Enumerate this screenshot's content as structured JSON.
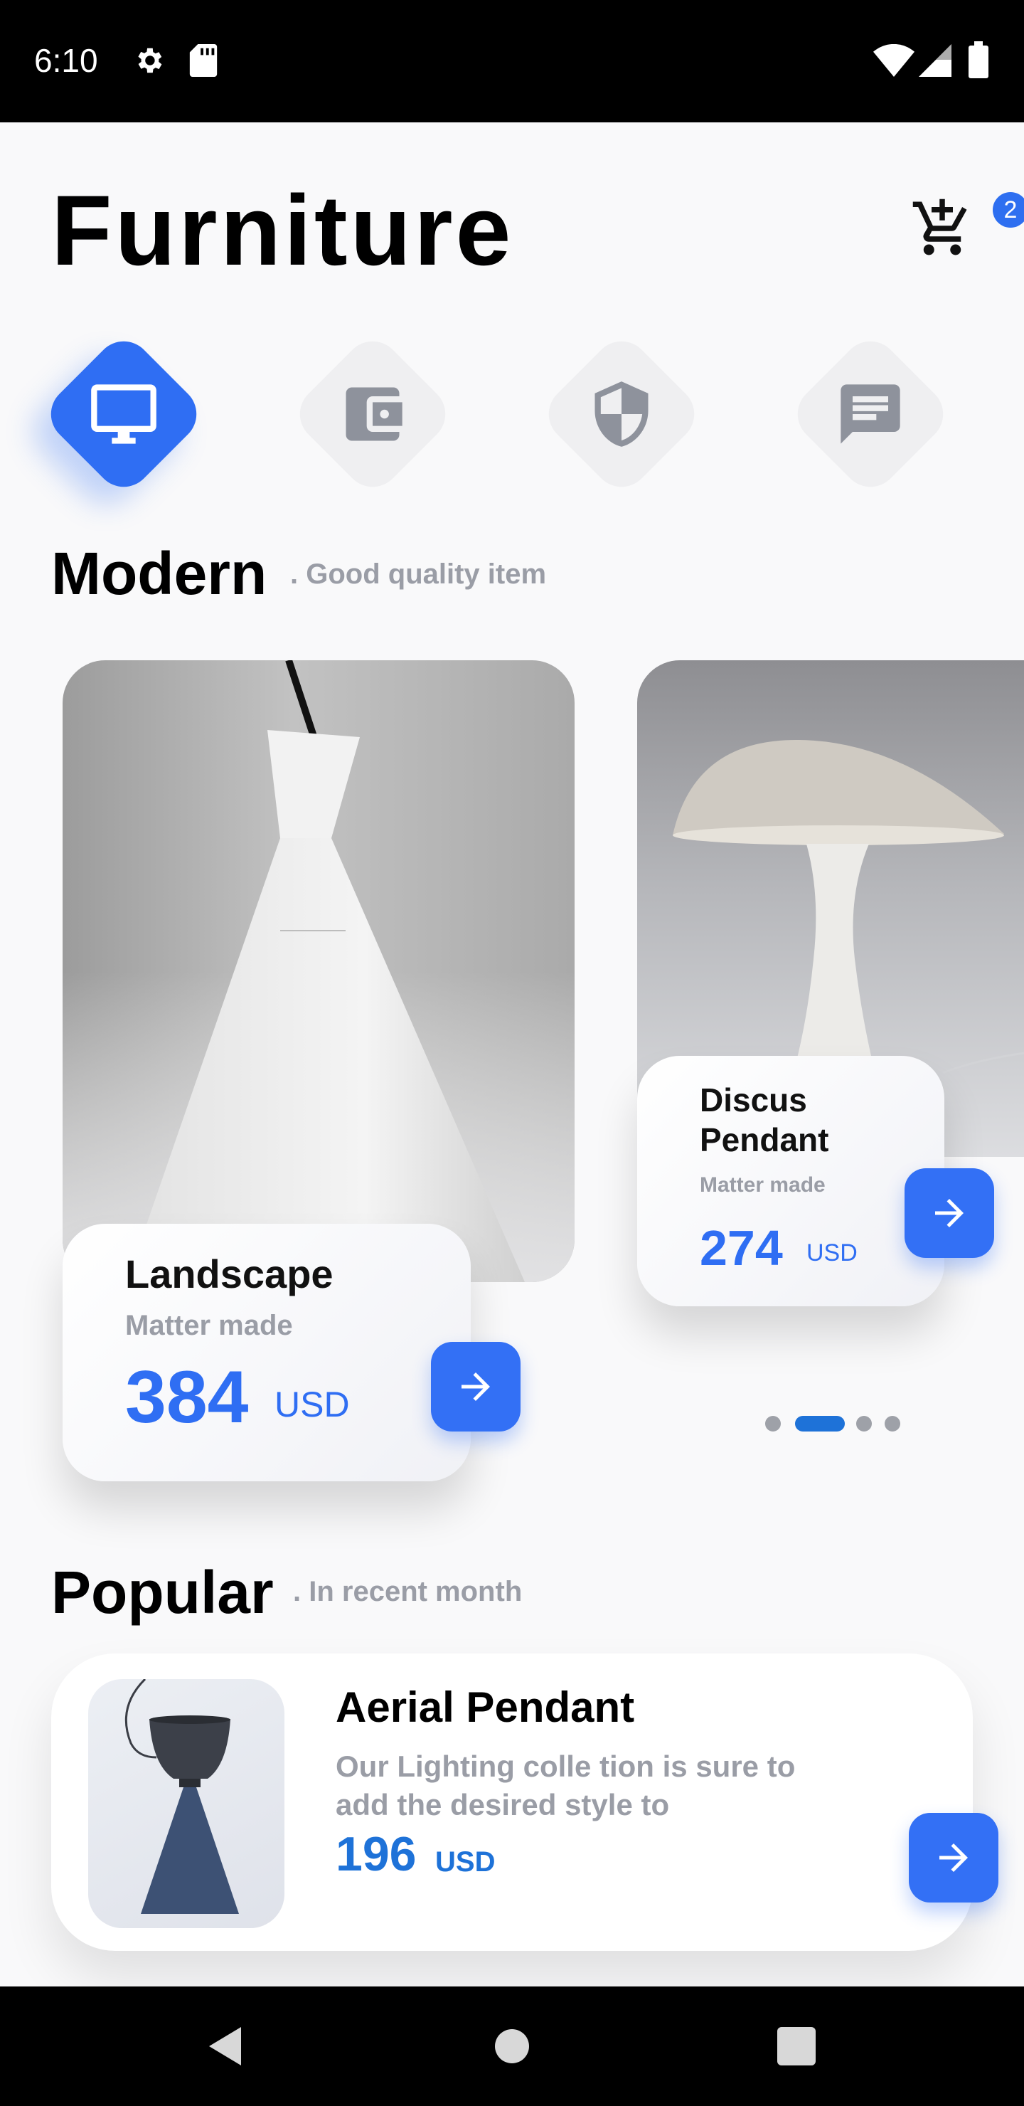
{
  "status_bar": {
    "time": "6:10",
    "left_icons": [
      "gear-icon",
      "sd-card-icon"
    ],
    "right_icons": [
      "wifi-icon",
      "signal-icon",
      "battery-icon"
    ]
  },
  "header": {
    "title": "Furniture",
    "cart_icon": "cart-add-icon",
    "cart_badge": "2"
  },
  "categories": [
    {
      "icon": "monitor-icon",
      "active": true
    },
    {
      "icon": "wallet-icon",
      "active": false
    },
    {
      "icon": "shield-icon",
      "active": false
    },
    {
      "icon": "chat-icon",
      "active": false
    }
  ],
  "modern": {
    "title": "Modern",
    "subtitle": ". Good quality item",
    "products": [
      {
        "name": "Landscape",
        "material": "Matter made",
        "price": "384",
        "currency": "USD"
      },
      {
        "name_line1": "Discus",
        "name_line2": "Pendant",
        "material": "Matter made",
        "price": "274",
        "currency": "USD"
      }
    ],
    "carousel": {
      "count": 4,
      "active_index": 1
    }
  },
  "popular": {
    "title": "Popular",
    "subtitle": ". In recent month",
    "item": {
      "name": "Aerial Pendant",
      "description_line1": "Our Lighting colle tion is sure to",
      "description_line2": "add the desired style to",
      "price": "196",
      "currency": "USD"
    }
  },
  "colors": {
    "accent": "#2f6ef3",
    "price_blue": "#1e72d8",
    "muted_text": "#9a9da6",
    "inactive_tab": "#efeff1",
    "background": "#f9f9fa"
  },
  "nav_bar": {
    "icons": [
      "back-icon",
      "home-icon",
      "recents-icon"
    ]
  }
}
